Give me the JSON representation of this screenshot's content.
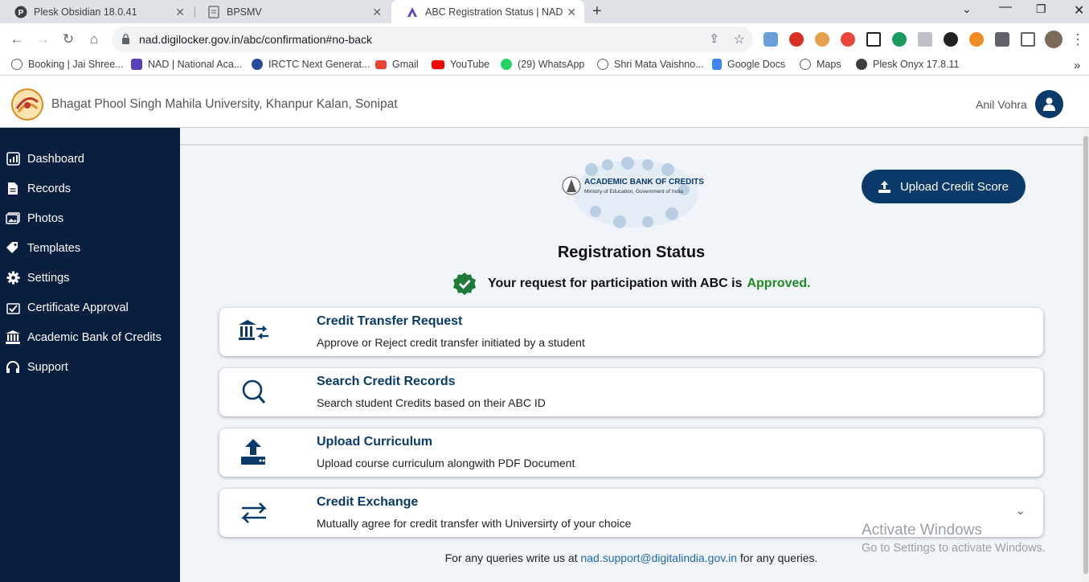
{
  "browser": {
    "tabs": [
      {
        "title": "Plesk Obsidian 18.0.41"
      },
      {
        "title": "BPSMV"
      },
      {
        "title": "ABC Registration Status | NAD"
      }
    ],
    "new_tab": "+",
    "url": "nad.digilocker.gov.in/abc/confirmation#no-back",
    "bookmarks": [
      {
        "label": "Booking | Jai Shree..."
      },
      {
        "label": "NAD | National Aca..."
      },
      {
        "label": "IRCTC Next Generat..."
      },
      {
        "label": "Gmail"
      },
      {
        "label": "YouTube"
      },
      {
        "label": "(29) WhatsApp"
      },
      {
        "label": "Shri Mata Vaishno..."
      },
      {
        "label": "Google Docs"
      },
      {
        "label": "Maps"
      },
      {
        "label": "Plesk Onyx 17.8.11"
      }
    ],
    "more_bookmarks": "»"
  },
  "header": {
    "university": "Bhagat Phool Singh Mahila University, Khanpur Kalan, Sonipat",
    "user": "Anil Vohra"
  },
  "sidebar": {
    "items": [
      {
        "label": "Dashboard",
        "icon": "dashboard-icon"
      },
      {
        "label": "Records",
        "icon": "records-icon"
      },
      {
        "label": "Photos",
        "icon": "photos-icon"
      },
      {
        "label": "Templates",
        "icon": "tag-icon"
      },
      {
        "label": "Settings",
        "icon": "gear-icon"
      },
      {
        "label": "Certificate Approval",
        "icon": "certificate-icon"
      },
      {
        "label": "Academic Bank of Credits",
        "icon": "bank-icon"
      },
      {
        "label": "Support",
        "icon": "headset-icon"
      }
    ]
  },
  "main": {
    "logo": {
      "title": "ACADEMIC BANK OF CREDITS",
      "subtitle": "Ministry of Education, Government of India"
    },
    "upload_button": "Upload Credit Score",
    "registration_title": "Registration Status",
    "status_prefix": "Your request for participation with ABC is",
    "status_value": "Approved.",
    "cards": [
      {
        "title": "Credit Transfer Request",
        "desc": "Approve or Reject credit transfer initiated by a student",
        "icon": "bank-transfer-icon"
      },
      {
        "title": "Search Credit Records",
        "desc": "Search student Credits based on their ABC ID",
        "icon": "search-icon"
      },
      {
        "title": "Upload Curriculum",
        "desc": "Upload course curriculum alongwith PDF Document",
        "icon": "upload-icon"
      },
      {
        "title": "Credit Exchange",
        "desc": "Mutually agree for credit transfer with Universirty of your choice",
        "icon": "exchange-icon"
      }
    ],
    "footer_prefix": "For any queries write us at",
    "footer_email": "nad.support@digitalindia.gov.in",
    "footer_suffix": "for any queries."
  },
  "watermark": {
    "line1": "Activate Windows",
    "line2": "Go to Settings to activate Windows."
  },
  "colors": {
    "sidebar": "#081f3f",
    "primary": "#0a3a6a",
    "approved": "#1f8a1f",
    "link": "#1f6aa8"
  }
}
